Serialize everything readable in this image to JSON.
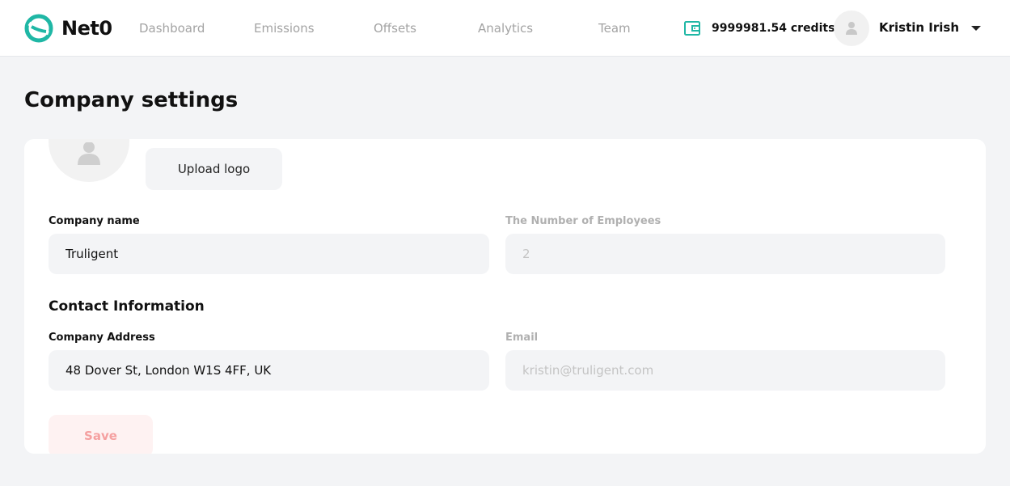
{
  "app": {
    "name": "Net0",
    "brand_color": "#1fb7a5"
  },
  "nav": {
    "items": [
      {
        "label": "Dashboard"
      },
      {
        "label": "Emissions"
      },
      {
        "label": "Offsets"
      },
      {
        "label": "Analytics"
      },
      {
        "label": "Team"
      }
    ]
  },
  "account": {
    "credits": "9999981.54 credits",
    "user_name": "Kristin Irish",
    "wallet_icon": "wallet-icon",
    "menu_icon": "chevron-down-icon"
  },
  "page": {
    "title": "Company settings"
  },
  "logo_section": {
    "upload_label": "Upload logo",
    "avatar_icon": "user-placeholder-icon"
  },
  "form": {
    "company_name": {
      "label": "Company name",
      "value": "Truligent"
    },
    "employees": {
      "label": "The Number of Employees",
      "value": "2"
    },
    "contact_title": "Contact Information",
    "address": {
      "label": "Company Address",
      "value": "48 Dover St, London W1S 4FF, UK"
    },
    "email": {
      "label": "Email",
      "value": "kristin@truligent.com"
    },
    "save_label": "Save",
    "save_color": "#f5a0a0"
  }
}
